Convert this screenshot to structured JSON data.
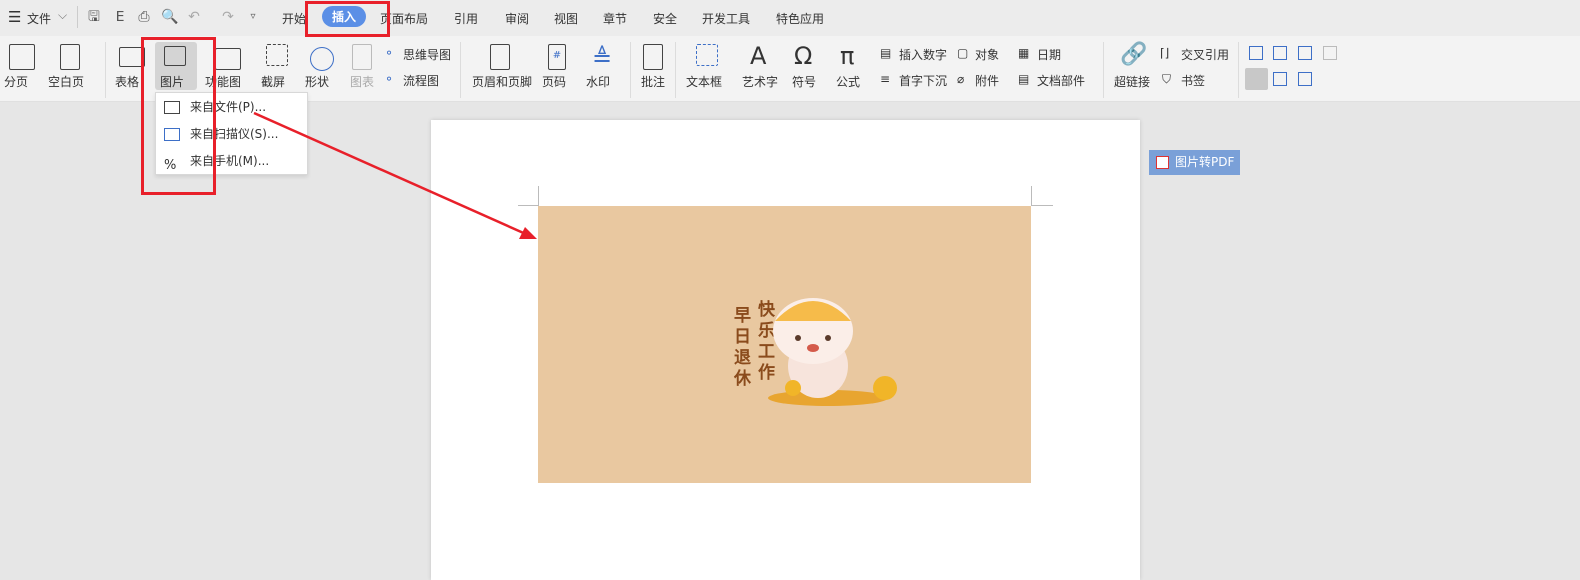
{
  "titlebar": {
    "menu_label": "文件",
    "tabs": [
      "开始",
      "插入",
      "页面布局",
      "引用",
      "审阅",
      "视图",
      "章节",
      "安全",
      "开发工具",
      "特色应用"
    ],
    "active_tab": "插入"
  },
  "ribbon": {
    "page_break": "分页",
    "blank_page": "空白页",
    "table": "表格",
    "picture": "图片",
    "function_chart": "功能图",
    "screenshot": "截屏",
    "shape": "形状",
    "chart": "图表",
    "mind_map": "思维导图",
    "flowchart": "流程图",
    "header_footer": "页眉和页脚",
    "page_number": "页码",
    "watermark": "水印",
    "comment": "批注",
    "text_box": "文本框",
    "word_art": "艺术字",
    "symbol": "符号",
    "formula": "公式",
    "insert_number": "插入数字",
    "drop_cap": "首字下沉",
    "object": "对象",
    "attachment": "附件",
    "date": "日期",
    "doc_parts": "文档部件",
    "hyperlink": "超链接",
    "cross_ref": "交叉引用",
    "bookmark": "书签"
  },
  "picture_menu": {
    "items": [
      "来自文件(P)...",
      "来自扫描仪(S)...",
      "来自手机(M)..."
    ]
  },
  "image": {
    "text_right": "快乐工作",
    "text_left": "早日退休"
  },
  "float_button": {
    "label": "图片转PDF"
  },
  "colors": {
    "accent": "#5b8fe6",
    "highlight": "#e8202a",
    "image_bg": "#e9c8a0"
  }
}
